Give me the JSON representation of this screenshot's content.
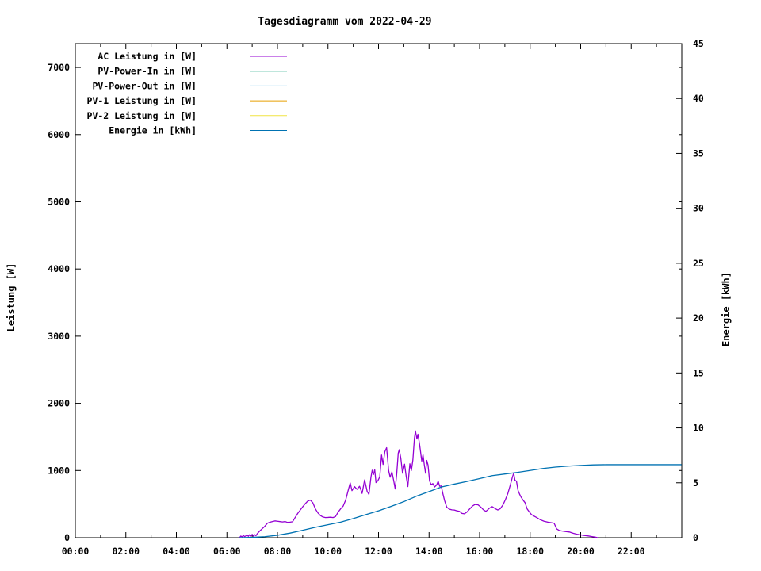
{
  "chart_data": {
    "type": "line",
    "title": "Tagesdiagramm vom 2022-04-29",
    "legend_position": "top-left-inside",
    "x_axis": {
      "range_hours": [
        0,
        24
      ],
      "major_tick_labels": [
        "00:00",
        "02:00",
        "04:00",
        "06:00",
        "08:00",
        "10:00",
        "12:00",
        "14:00",
        "16:00",
        "18:00",
        "20:00",
        "22:00"
      ],
      "major_tick_hours": [
        0,
        2,
        4,
        6,
        8,
        10,
        12,
        14,
        16,
        18,
        20,
        22
      ],
      "minor_tick_hours": [
        1,
        3,
        5,
        7,
        9,
        11,
        13,
        15,
        17,
        19,
        21,
        23
      ]
    },
    "y_left": {
      "label": "Leistung [W]",
      "ticks": [
        0,
        1000,
        2000,
        3000,
        4000,
        5000,
        6000,
        7000
      ],
      "range": [
        0,
        7355
      ]
    },
    "y_right": {
      "label": "Energie [kWh]",
      "ticks": [
        0,
        5,
        10,
        15,
        20,
        25,
        30,
        35,
        40,
        45
      ],
      "range": [
        0,
        45
      ]
    },
    "series": [
      {
        "name": "AC Leistung in [W]",
        "color": "#9400d3",
        "axis": "left",
        "points": [
          [
            6.5,
            0
          ],
          [
            6.55,
            25
          ],
          [
            6.6,
            10
          ],
          [
            6.65,
            35
          ],
          [
            6.7,
            15
          ],
          [
            6.8,
            40
          ],
          [
            6.85,
            20
          ],
          [
            6.9,
            45
          ],
          [
            6.95,
            25
          ],
          [
            7.0,
            50
          ],
          [
            7.05,
            20
          ],
          [
            7.1,
            45
          ],
          [
            7.15,
            30
          ],
          [
            7.2,
            60
          ],
          [
            7.3,
            100
          ],
          [
            7.4,
            135
          ],
          [
            7.5,
            170
          ],
          [
            7.6,
            215
          ],
          [
            7.7,
            230
          ],
          [
            7.8,
            240
          ],
          [
            7.9,
            250
          ],
          [
            8.0,
            245
          ],
          [
            8.1,
            240
          ],
          [
            8.2,
            235
          ],
          [
            8.3,
            240
          ],
          [
            8.4,
            228
          ],
          [
            8.5,
            232
          ],
          [
            8.6,
            238
          ],
          [
            8.7,
            300
          ],
          [
            8.8,
            360
          ],
          [
            8.9,
            410
          ],
          [
            9.0,
            460
          ],
          [
            9.1,
            505
          ],
          [
            9.2,
            545
          ],
          [
            9.3,
            560
          ],
          [
            9.4,
            520
          ],
          [
            9.5,
            430
          ],
          [
            9.6,
            370
          ],
          [
            9.7,
            330
          ],
          [
            9.8,
            308
          ],
          [
            9.9,
            300
          ],
          [
            10.0,
            302
          ],
          [
            10.1,
            305
          ],
          [
            10.2,
            300
          ],
          [
            10.3,
            315
          ],
          [
            10.4,
            380
          ],
          [
            10.5,
            430
          ],
          [
            10.6,
            470
          ],
          [
            10.7,
            560
          ],
          [
            10.8,
            705
          ],
          [
            10.88,
            815
          ],
          [
            10.95,
            700
          ],
          [
            11.05,
            760
          ],
          [
            11.15,
            720
          ],
          [
            11.25,
            765
          ],
          [
            11.35,
            660
          ],
          [
            11.45,
            860
          ],
          [
            11.55,
            690
          ],
          [
            11.62,
            645
          ],
          [
            11.7,
            900
          ],
          [
            11.75,
            1005
          ],
          [
            11.8,
            940
          ],
          [
            11.85,
            1010
          ],
          [
            11.9,
            820
          ],
          [
            11.97,
            845
          ],
          [
            12.05,
            905
          ],
          [
            12.12,
            1230
          ],
          [
            12.18,
            1090
          ],
          [
            12.25,
            1280
          ],
          [
            12.32,
            1340
          ],
          [
            12.4,
            1000
          ],
          [
            12.46,
            900
          ],
          [
            12.53,
            980
          ],
          [
            12.6,
            850
          ],
          [
            12.66,
            725
          ],
          [
            12.72,
            950
          ],
          [
            12.78,
            1260
          ],
          [
            12.82,
            1310
          ],
          [
            12.88,
            1190
          ],
          [
            12.95,
            960
          ],
          [
            13.03,
            1095
          ],
          [
            13.1,
            900
          ],
          [
            13.16,
            760
          ],
          [
            13.24,
            1100
          ],
          [
            13.3,
            1000
          ],
          [
            13.36,
            1160
          ],
          [
            13.42,
            1480
          ],
          [
            13.46,
            1590
          ],
          [
            13.52,
            1470
          ],
          [
            13.56,
            1540
          ],
          [
            13.62,
            1400
          ],
          [
            13.66,
            1290
          ],
          [
            13.71,
            1140
          ],
          [
            13.76,
            1235
          ],
          [
            13.81,
            1090
          ],
          [
            13.86,
            960
          ],
          [
            13.91,
            1150
          ],
          [
            13.96,
            1080
          ],
          [
            14.02,
            845
          ],
          [
            14.08,
            790
          ],
          [
            14.15,
            805
          ],
          [
            14.22,
            755
          ],
          [
            14.3,
            785
          ],
          [
            14.36,
            840
          ],
          [
            14.42,
            765
          ],
          [
            14.48,
            770
          ],
          [
            14.55,
            650
          ],
          [
            14.62,
            545
          ],
          [
            14.7,
            455
          ],
          [
            14.8,
            425
          ],
          [
            14.9,
            415
          ],
          [
            15.0,
            412
          ],
          [
            15.1,
            400
          ],
          [
            15.2,
            392
          ],
          [
            15.3,
            362
          ],
          [
            15.4,
            356
          ],
          [
            15.5,
            382
          ],
          [
            15.6,
            425
          ],
          [
            15.72,
            472
          ],
          [
            15.82,
            495
          ],
          [
            15.94,
            488
          ],
          [
            16.05,
            455
          ],
          [
            16.15,
            415
          ],
          [
            16.25,
            392
          ],
          [
            16.4,
            442
          ],
          [
            16.5,
            462
          ],
          [
            16.62,
            432
          ],
          [
            16.72,
            412
          ],
          [
            16.82,
            432
          ],
          [
            16.92,
            485
          ],
          [
            17.02,
            565
          ],
          [
            17.12,
            660
          ],
          [
            17.22,
            790
          ],
          [
            17.3,
            905
          ],
          [
            17.35,
            960
          ],
          [
            17.4,
            855
          ],
          [
            17.46,
            840
          ],
          [
            17.52,
            705
          ],
          [
            17.58,
            650
          ],
          [
            17.64,
            605
          ],
          [
            17.72,
            560
          ],
          [
            17.8,
            520
          ],
          [
            17.88,
            430
          ],
          [
            17.95,
            392
          ],
          [
            18.05,
            345
          ],
          [
            18.15,
            322
          ],
          [
            18.25,
            302
          ],
          [
            18.4,
            268
          ],
          [
            18.55,
            245
          ],
          [
            18.7,
            232
          ],
          [
            18.85,
            222
          ],
          [
            18.95,
            215
          ],
          [
            19.05,
            130
          ],
          [
            19.15,
            108
          ],
          [
            19.25,
            100
          ],
          [
            19.4,
            92
          ],
          [
            19.55,
            85
          ],
          [
            19.7,
            66
          ],
          [
            19.85,
            52
          ],
          [
            20.0,
            42
          ],
          [
            20.15,
            32
          ],
          [
            20.3,
            26
          ],
          [
            20.45,
            16
          ],
          [
            20.58,
            8
          ],
          [
            20.68,
            0
          ]
        ]
      },
      {
        "name": "PV-Power-In in [W]",
        "color": "#009e73",
        "axis": "left",
        "points": []
      },
      {
        "name": "PV-Power-Out in [W]",
        "color": "#56b4e9",
        "axis": "left",
        "points": []
      },
      {
        "name": "PV-1 Leistung in [W]",
        "color": "#e69f00",
        "axis": "left",
        "points": []
      },
      {
        "name": "PV-2 Leistung in [W]",
        "color": "#f0e442",
        "axis": "left",
        "points": []
      },
      {
        "name": "Energie in [kWh]",
        "color": "#0072b2",
        "axis": "right",
        "points": [
          [
            6.5,
            0.0
          ],
          [
            7.0,
            0.03
          ],
          [
            7.5,
            0.09
          ],
          [
            8.0,
            0.22
          ],
          [
            8.5,
            0.42
          ],
          [
            9.0,
            0.68
          ],
          [
            9.5,
            0.95
          ],
          [
            10.0,
            1.18
          ],
          [
            10.5,
            1.42
          ],
          [
            11.0,
            1.74
          ],
          [
            11.5,
            2.1
          ],
          [
            12.0,
            2.45
          ],
          [
            12.5,
            2.85
          ],
          [
            13.0,
            3.28
          ],
          [
            13.5,
            3.78
          ],
          [
            14.0,
            4.2
          ],
          [
            14.5,
            4.62
          ],
          [
            15.0,
            4.88
          ],
          [
            15.5,
            5.12
          ],
          [
            16.0,
            5.38
          ],
          [
            16.5,
            5.65
          ],
          [
            17.0,
            5.8
          ],
          [
            17.5,
            5.95
          ],
          [
            18.0,
            6.12
          ],
          [
            18.5,
            6.3
          ],
          [
            19.0,
            6.43
          ],
          [
            19.5,
            6.52
          ],
          [
            20.0,
            6.58
          ],
          [
            20.5,
            6.63
          ],
          [
            21.0,
            6.65
          ],
          [
            22.0,
            6.65
          ],
          [
            23.0,
            6.65
          ],
          [
            23.99,
            6.65
          ]
        ]
      }
    ]
  }
}
